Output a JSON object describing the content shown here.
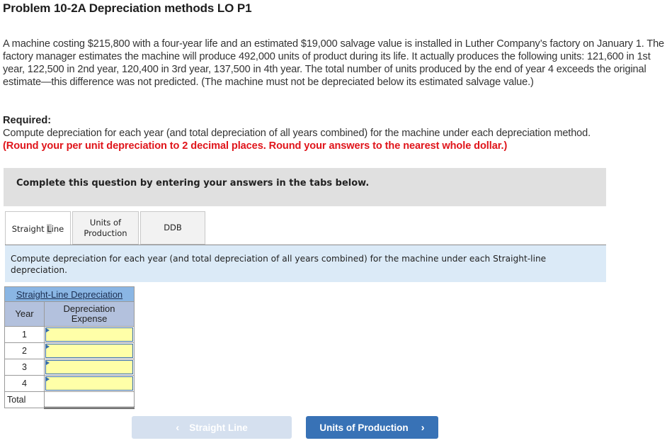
{
  "problem": {
    "title": "Problem 10-2A Depreciation methods LO P1",
    "paragraph": "A machine costing $215,800 with a four-year life and an estimated $19,000 salvage value is installed in Luther Company’s factory on January 1. The factory manager estimates the machine will produce 492,000 units of product during its life. It actually produces the following units: 121,600 in 1st year, 122,500 in 2nd year, 120,400 in 3rd year, 137,500 in 4th year. The total number of units produced by the end of year 4 exceeds the original estimate—this difference was not predicted. (The machine must not be depreciated below its estimated salvage value.)",
    "required_label": "Required:",
    "required_text": "Compute depreciation for each year (and total depreciation of all years combined) for the machine under each depreciation method.",
    "required_note": "(Round your per unit depreciation to 2 decimal places. Round your answers to the nearest whole dollar.)"
  },
  "instructions": "Complete this question by entering your answers in the tabs below.",
  "tabs": [
    {
      "label_pre": "Straight ",
      "label_mark": "L",
      "label_post": "ine",
      "active": true
    },
    {
      "label_line1": "Units of",
      "label_line2": "Production",
      "active": false
    },
    {
      "label": "DDB",
      "active": false
    }
  ],
  "tab_description": "Compute depreciation for each year (and total depreciation of all years combined) for the machine under each Straight-line depreciation.",
  "table": {
    "title": "Straight-Line Depreciation",
    "col_year": "Year",
    "col_expense_line1": "Depreciation",
    "col_expense_line2": "Expense",
    "rows": [
      {
        "year": "1",
        "value": ""
      },
      {
        "year": "2",
        "value": ""
      },
      {
        "year": "3",
        "value": ""
      },
      {
        "year": "4",
        "value": ""
      }
    ],
    "total_label": "Total",
    "total_value": ""
  },
  "nav": {
    "prev_label": "Straight Line",
    "prev_icon": "‹",
    "next_label": "Units of Production",
    "next_icon": "›"
  },
  "colors": {
    "required_note": "#e0151b",
    "next_button": "#3872b6",
    "prev_button_disabled": "#d5e0ef",
    "input_fill": "#ffffa8",
    "table_title_bg": "#8ab6e4",
    "table_header_bg": "#b3c1dd",
    "description_bg": "#dbeaf7"
  }
}
